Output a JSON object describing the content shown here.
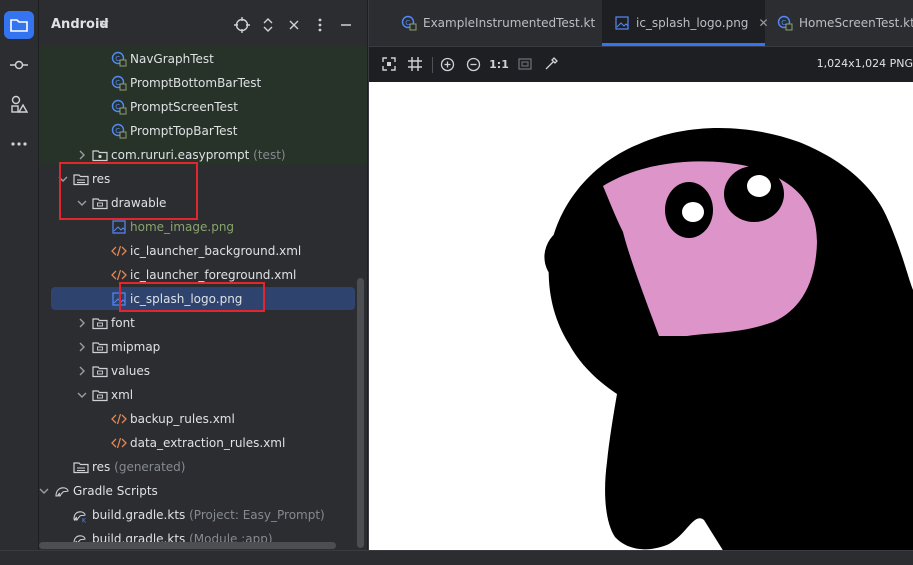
{
  "project_panel": {
    "view_selector": "Android",
    "tree": [
      {
        "label": "NavGraphTest",
        "icon": "test-class-icon",
        "depth": 4,
        "chev": "none"
      },
      {
        "label": "PromptBottomBarTest",
        "icon": "test-class-icon",
        "depth": 4,
        "chev": "none"
      },
      {
        "label": "PromptScreenTest",
        "icon": "test-class-icon",
        "depth": 4,
        "chev": "none"
      },
      {
        "label": "PromptTopBarTest",
        "icon": "test-class-icon",
        "depth": 4,
        "chev": "none"
      },
      {
        "label": "com.rururi.easyprompt",
        "suffix": "(test)",
        "icon": "package-icon",
        "depth": 3,
        "chev": "right"
      },
      {
        "label": "res",
        "icon": "res-folder-icon",
        "depth": 2,
        "chev": "down"
      },
      {
        "label": "drawable",
        "icon": "folder-icon",
        "depth": 3,
        "chev": "down"
      },
      {
        "label": "home_image.png",
        "icon": "image-file-icon",
        "depth": 4,
        "chev": "none",
        "style": "green"
      },
      {
        "label": "ic_launcher_background.xml",
        "icon": "xml-file-icon",
        "depth": 4,
        "chev": "none"
      },
      {
        "label": "ic_launcher_foreground.xml",
        "icon": "xml-file-icon",
        "depth": 4,
        "chev": "none"
      },
      {
        "label": "ic_splash_logo.png",
        "icon": "image-file-icon",
        "depth": 4,
        "chev": "none",
        "selected": true
      },
      {
        "label": "font",
        "icon": "folder-icon",
        "depth": 3,
        "chev": "right"
      },
      {
        "label": "mipmap",
        "icon": "folder-icon",
        "depth": 3,
        "chev": "right"
      },
      {
        "label": "values",
        "icon": "folder-icon",
        "depth": 3,
        "chev": "right"
      },
      {
        "label": "xml",
        "icon": "folder-icon",
        "depth": 3,
        "chev": "down"
      },
      {
        "label": "backup_rules.xml",
        "icon": "xml-file-icon",
        "depth": 4,
        "chev": "none"
      },
      {
        "label": "data_extraction_rules.xml",
        "icon": "xml-file-icon",
        "depth": 4,
        "chev": "none"
      },
      {
        "label": "res",
        "suffix": "(generated)",
        "icon": "res-folder-icon",
        "depth": 2,
        "chev": "none"
      },
      {
        "label": "Gradle Scripts",
        "icon": "gradle-icon",
        "depth": 1,
        "chev": "down"
      },
      {
        "label": "build.gradle.kts",
        "suffix": "(Project: Easy_Prompt)",
        "icon": "gradle-file-icon",
        "depth": 2,
        "chev": "none"
      },
      {
        "label": "build.gradle.kts",
        "suffix": "(Module :app)",
        "icon": "gradle-file-icon",
        "depth": 2,
        "chev": "none"
      }
    ]
  },
  "editor": {
    "tabs": [
      {
        "label": "ExampleInstrumentedTest.kt",
        "icon": "test-class-icon",
        "active": false
      },
      {
        "label": "ic_splash_logo.png",
        "icon": "image-file-icon",
        "active": true
      },
      {
        "label": "HomeScreenTest.kt",
        "icon": "test-class-icon",
        "active": false
      }
    ],
    "toolbar": {
      "actual_size_label": "1:1"
    },
    "image_dimensions": "1,024x1,024 PNG",
    "image_colors": {
      "ink": "#000000",
      "face": "#dd94c9",
      "eyes": "#ffffff",
      "background": "#ffffff"
    }
  },
  "colors": {
    "accent": "#3574f0",
    "selection": "#2e436e",
    "highlight_box": "#e3252d"
  }
}
